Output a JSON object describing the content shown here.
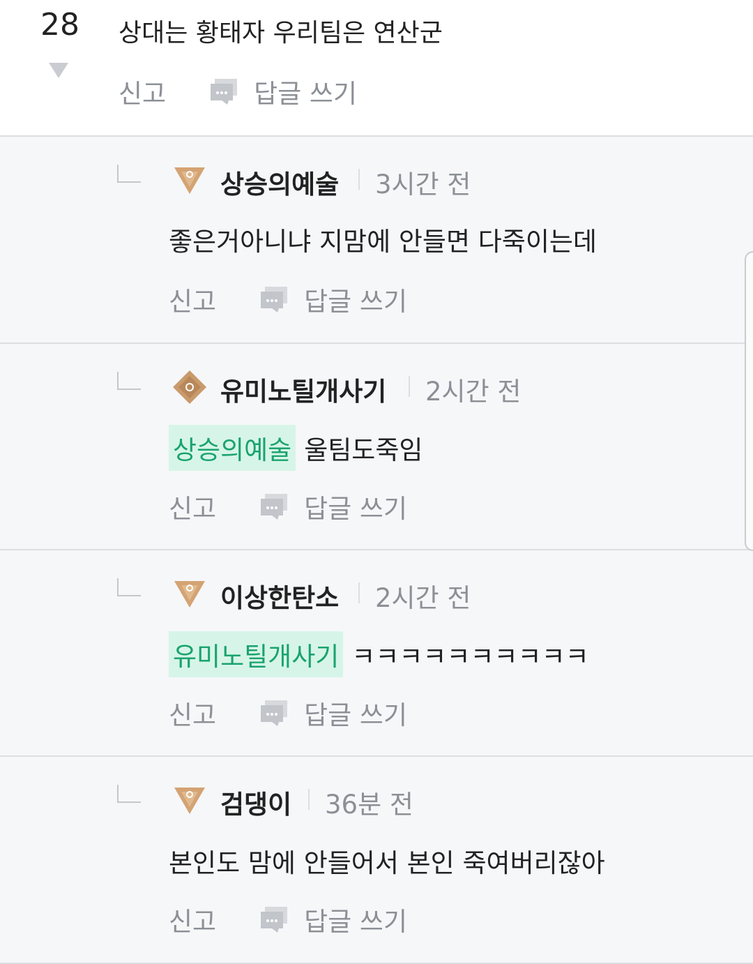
{
  "parent_comment": {
    "vote_count": "28",
    "text": "상대는 황태자 우리팀은 연산군",
    "report_label": "신고",
    "reply_label": "답글 쓰기"
  },
  "replies": [
    {
      "nickname": "상승의예술",
      "time": "3시간 전",
      "mention": "",
      "text": "좋은거아니냐 지맘에 안들면 다죽이는데",
      "report_label": "신고",
      "reply_label": "답글 쓰기",
      "rank_icon": "triangle-rank-icon"
    },
    {
      "nickname": "유미노틸개사기",
      "time": "2시간 전",
      "mention": "상승의예술",
      "text": "울팀도죽임",
      "report_label": "신고",
      "reply_label": "답글 쓰기",
      "rank_icon": "diamond-rank-icon"
    },
    {
      "nickname": "이상한탄소",
      "time": "2시간 전",
      "mention": "유미노틸개사기",
      "text": "ㅋㅋㅋㅋㅋㅋㅋㅋㅋㅋ",
      "report_label": "신고",
      "reply_label": "답글 쓰기",
      "rank_icon": "triangle-rank-icon"
    },
    {
      "nickname": "검댕이",
      "time": "36분 전",
      "mention": "",
      "text": "본인도 맘에 안들어서 본인 죽여버리잖아",
      "report_label": "신고",
      "reply_label": "답글 쓰기",
      "rank_icon": "triangle-rank-icon"
    }
  ],
  "colors": {
    "mention_bg": "#d6f5e8",
    "mention_text": "#1aa36e",
    "rank_gold": "#d4a373",
    "reply_bg": "#f6f7f9"
  }
}
